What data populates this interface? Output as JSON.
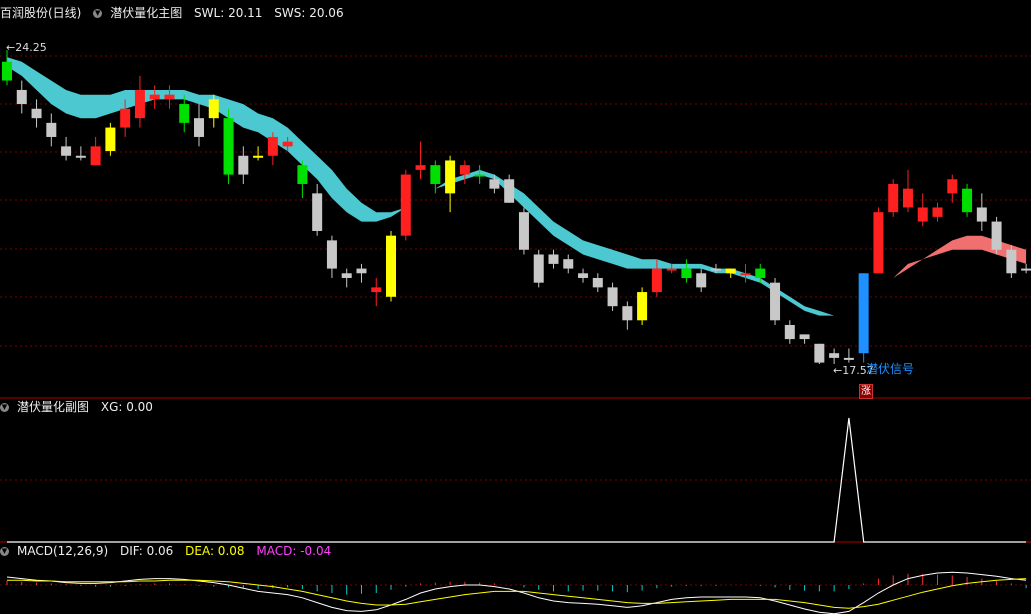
{
  "main_panel": {
    "stock_name": "百润股份(日线)",
    "indicator_name": "潜伏量化主图",
    "swl_label": "SWL: 20.11",
    "sws_label": "SWS: 20.06",
    "high_label": "24.25",
    "low_label": "17.57",
    "signal_label": "潜伏信号",
    "rise_badge": "涨"
  },
  "sub_panel": {
    "indicator_name": "潜伏量化副图",
    "xg_label": "XG: 0.00"
  },
  "macd_panel": {
    "indicator_name": "MACD(12,26,9)",
    "dif_label": "DIF: 0.06",
    "dea_label": "DEA: 0.08",
    "macd_label": "MACD: -0.04"
  },
  "colors": {
    "up": "#ff2020",
    "down": "#c8c8c8",
    "strong_up": "#ffff00",
    "strong_down": "#00e000",
    "signal": "#1e90ff",
    "band": "#4cc8d0",
    "band_up": "#f07070",
    "grid": "#7a0000",
    "divider": "#b00000"
  },
  "chart_data": {
    "type": "candlestick",
    "price_range_visible": [
      17.57,
      24.25
    ],
    "candles": [
      {
        "o": 24.0,
        "c": 23.6,
        "h": 24.25,
        "l": 23.5,
        "k": "g"
      },
      {
        "o": 23.4,
        "c": 23.1,
        "h": 23.6,
        "l": 22.9,
        "k": "d"
      },
      {
        "o": 23.0,
        "c": 22.8,
        "h": 23.2,
        "l": 22.6,
        "k": "d"
      },
      {
        "o": 22.7,
        "c": 22.4,
        "h": 22.9,
        "l": 22.2,
        "k": "d"
      },
      {
        "o": 22.2,
        "c": 22.0,
        "h": 22.4,
        "l": 21.9,
        "k": "d"
      },
      {
        "o": 22.0,
        "c": 22.0,
        "h": 22.2,
        "l": 21.9,
        "k": "d"
      },
      {
        "o": 21.8,
        "c": 22.2,
        "h": 22.4,
        "l": 21.8,
        "k": "u"
      },
      {
        "o": 22.1,
        "c": 22.6,
        "h": 22.7,
        "l": 22.0,
        "k": "y"
      },
      {
        "o": 22.6,
        "c": 23.0,
        "h": 23.2,
        "l": 22.4,
        "k": "u"
      },
      {
        "o": 22.8,
        "c": 23.4,
        "h": 23.7,
        "l": 22.6,
        "k": "u"
      },
      {
        "o": 23.2,
        "c": 23.3,
        "h": 23.5,
        "l": 23.0,
        "k": "u"
      },
      {
        "o": 23.2,
        "c": 23.3,
        "h": 23.5,
        "l": 23.0,
        "k": "u"
      },
      {
        "o": 23.1,
        "c": 22.7,
        "h": 23.3,
        "l": 22.5,
        "k": "g"
      },
      {
        "o": 22.8,
        "c": 22.4,
        "h": 23.1,
        "l": 22.2,
        "k": "d"
      },
      {
        "o": 22.8,
        "c": 23.2,
        "h": 23.3,
        "l": 22.6,
        "k": "y"
      },
      {
        "o": 22.8,
        "c": 21.6,
        "h": 23.0,
        "l": 21.4,
        "k": "g"
      },
      {
        "o": 22.0,
        "c": 21.6,
        "h": 22.2,
        "l": 21.4,
        "k": "d"
      },
      {
        "o": 22.0,
        "c": 22.0,
        "h": 22.2,
        "l": 21.9,
        "k": "y"
      },
      {
        "o": 22.0,
        "c": 22.4,
        "h": 22.5,
        "l": 21.8,
        "k": "u"
      },
      {
        "o": 22.2,
        "c": 22.3,
        "h": 22.4,
        "l": 22.1,
        "k": "u"
      },
      {
        "o": 21.8,
        "c": 21.4,
        "h": 21.9,
        "l": 21.1,
        "k": "g"
      },
      {
        "o": 21.2,
        "c": 20.4,
        "h": 21.4,
        "l": 20.3,
        "k": "d"
      },
      {
        "o": 20.2,
        "c": 19.6,
        "h": 20.3,
        "l": 19.4,
        "k": "d"
      },
      {
        "o": 19.5,
        "c": 19.4,
        "h": 19.6,
        "l": 19.2,
        "k": "d"
      },
      {
        "o": 19.6,
        "c": 19.5,
        "h": 19.7,
        "l": 19.3,
        "k": "d"
      },
      {
        "o": 19.2,
        "c": 19.1,
        "h": 19.4,
        "l": 18.8,
        "k": "u"
      },
      {
        "o": 19.0,
        "c": 20.3,
        "h": 20.4,
        "l": 18.9,
        "k": "y"
      },
      {
        "o": 20.3,
        "c": 21.6,
        "h": 21.7,
        "l": 20.2,
        "k": "u"
      },
      {
        "o": 21.7,
        "c": 21.8,
        "h": 22.3,
        "l": 21.5,
        "k": "u"
      },
      {
        "o": 21.8,
        "c": 21.4,
        "h": 21.9,
        "l": 21.2,
        "k": "g"
      },
      {
        "o": 21.2,
        "c": 21.9,
        "h": 22.0,
        "l": 20.8,
        "k": "y"
      },
      {
        "o": 21.8,
        "c": 21.6,
        "h": 21.9,
        "l": 21.4,
        "k": "u"
      },
      {
        "o": 21.6,
        "c": 21.6,
        "h": 21.8,
        "l": 21.4,
        "k": "g"
      },
      {
        "o": 21.5,
        "c": 21.3,
        "h": 21.6,
        "l": 21.2,
        "k": "d"
      },
      {
        "o": 21.5,
        "c": 21.0,
        "h": 21.6,
        "l": 21.0,
        "k": "d"
      },
      {
        "o": 20.8,
        "c": 20.0,
        "h": 20.9,
        "l": 19.9,
        "k": "d"
      },
      {
        "o": 19.9,
        "c": 19.3,
        "h": 20.0,
        "l": 19.2,
        "k": "d"
      },
      {
        "o": 19.9,
        "c": 19.7,
        "h": 20.0,
        "l": 19.6,
        "k": "d"
      },
      {
        "o": 19.8,
        "c": 19.6,
        "h": 19.9,
        "l": 19.5,
        "k": "d"
      },
      {
        "o": 19.5,
        "c": 19.4,
        "h": 19.6,
        "l": 19.3,
        "k": "d"
      },
      {
        "o": 19.4,
        "c": 19.2,
        "h": 19.5,
        "l": 19.1,
        "k": "d"
      },
      {
        "o": 19.2,
        "c": 18.8,
        "h": 19.3,
        "l": 18.7,
        "k": "d"
      },
      {
        "o": 18.8,
        "c": 18.5,
        "h": 18.9,
        "l": 18.3,
        "k": "d"
      },
      {
        "o": 18.5,
        "c": 19.1,
        "h": 19.2,
        "l": 18.4,
        "k": "y"
      },
      {
        "o": 19.1,
        "c": 19.6,
        "h": 19.8,
        "l": 19.0,
        "k": "u"
      },
      {
        "o": 19.6,
        "c": 19.6,
        "h": 19.7,
        "l": 19.5,
        "k": "u"
      },
      {
        "o": 19.6,
        "c": 19.4,
        "h": 19.8,
        "l": 19.3,
        "k": "g"
      },
      {
        "o": 19.5,
        "c": 19.2,
        "h": 19.6,
        "l": 19.1,
        "k": "d"
      },
      {
        "o": 19.6,
        "c": 19.6,
        "h": 19.7,
        "l": 19.5,
        "k": "d"
      },
      {
        "o": 19.5,
        "c": 19.6,
        "h": 19.6,
        "l": 19.4,
        "k": "y"
      },
      {
        "o": 19.5,
        "c": 19.5,
        "h": 19.7,
        "l": 19.3,
        "k": "u"
      },
      {
        "o": 19.6,
        "c": 19.4,
        "h": 19.7,
        "l": 19.3,
        "k": "g"
      },
      {
        "o": 19.3,
        "c": 18.5,
        "h": 19.4,
        "l": 18.4,
        "k": "d"
      },
      {
        "o": 18.4,
        "c": 18.1,
        "h": 18.5,
        "l": 18.0,
        "k": "d"
      },
      {
        "o": 18.2,
        "c": 18.1,
        "h": 18.2,
        "l": 18.0,
        "k": "d"
      },
      {
        "o": 18.0,
        "c": 17.6,
        "h": 18.0,
        "l": 17.57,
        "k": "d"
      },
      {
        "o": 17.8,
        "c": 17.7,
        "h": 17.9,
        "l": 17.57,
        "k": "d"
      },
      {
        "o": 17.7,
        "c": 17.7,
        "h": 17.9,
        "l": 17.6,
        "k": "d"
      },
      {
        "o": 17.8,
        "c": 19.5,
        "h": 19.5,
        "l": 17.6,
        "k": "s"
      },
      {
        "o": 19.5,
        "c": 20.8,
        "h": 20.9,
        "l": 19.5,
        "k": "u"
      },
      {
        "o": 20.8,
        "c": 21.4,
        "h": 21.5,
        "l": 20.7,
        "k": "u"
      },
      {
        "o": 20.9,
        "c": 21.3,
        "h": 21.7,
        "l": 20.8,
        "k": "u"
      },
      {
        "o": 20.6,
        "c": 20.9,
        "h": 21.2,
        "l": 20.5,
        "k": "u"
      },
      {
        "o": 20.9,
        "c": 20.7,
        "h": 21.0,
        "l": 20.6,
        "k": "u"
      },
      {
        "o": 21.2,
        "c": 21.5,
        "h": 21.6,
        "l": 21.0,
        "k": "u"
      },
      {
        "o": 21.3,
        "c": 20.8,
        "h": 21.4,
        "l": 20.7,
        "k": "g"
      },
      {
        "o": 20.9,
        "c": 20.6,
        "h": 21.2,
        "l": 20.4,
        "k": "d"
      },
      {
        "o": 20.6,
        "c": 20.0,
        "h": 20.7,
        "l": 19.9,
        "k": "d"
      },
      {
        "o": 20.0,
        "c": 19.5,
        "h": 20.1,
        "l": 19.4,
        "k": "d"
      },
      {
        "o": 19.6,
        "c": 19.6,
        "h": 19.7,
        "l": 19.5,
        "k": "d"
      }
    ],
    "band_lower": [
      23.9,
      23.7,
      23.4,
      23.1,
      22.9,
      22.8,
      22.8,
      22.9,
      23.0,
      23.1,
      23.2,
      23.2,
      23.2,
      23.1,
      23.0,
      22.8,
      22.6,
      22.5,
      22.3,
      22.1,
      21.8,
      21.5,
      21.1,
      20.8,
      20.6,
      20.6,
      20.7,
      20.9,
      21.1,
      21.3,
      21.4,
      21.5,
      21.6,
      21.5,
      21.2,
      20.9,
      20.6,
      20.3,
      20.1,
      19.9,
      19.8,
      19.7,
      19.6,
      19.6,
      19.6,
      19.6,
      19.6,
      19.6,
      19.5,
      19.5,
      19.4,
      19.3,
      19.1,
      18.9,
      18.7,
      18.6,
      18.6,
      18.6,
      18.8,
      19.1,
      19.4,
      19.7,
      19.8,
      19.9,
      20.0,
      20.0,
      20.0,
      19.9,
      19.8,
      19.7
    ],
    "band_upper": [
      24.1,
      24.0,
      23.8,
      23.6,
      23.4,
      23.3,
      23.3,
      23.3,
      23.4,
      23.4,
      23.4,
      23.4,
      23.4,
      23.3,
      23.3,
      23.2,
      23.1,
      22.9,
      22.8,
      22.6,
      22.3,
      22.0,
      21.7,
      21.3,
      21.0,
      20.8,
      20.8,
      20.9,
      21.1,
      21.3,
      21.5,
      21.6,
      21.7,
      21.6,
      21.4,
      21.2,
      20.9,
      20.6,
      20.4,
      20.2,
      20.1,
      20.0,
      19.9,
      19.8,
      19.8,
      19.7,
      19.7,
      19.7,
      19.6,
      19.6,
      19.5,
      19.4,
      19.2,
      19.0,
      18.8,
      18.7,
      18.6,
      18.6,
      18.8,
      19.1,
      19.4,
      19.6,
      19.8,
      20.0,
      20.2,
      20.3,
      20.3,
      20.2,
      20.1,
      20.0
    ],
    "signal_index": 57,
    "xg": [
      0,
      0,
      0,
      0,
      0,
      0,
      0,
      0,
      0,
      0,
      0,
      0,
      0,
      0,
      0,
      0,
      0,
      0,
      0,
      0,
      0,
      0,
      0,
      0,
      0,
      0,
      0,
      0,
      0,
      0,
      0,
      0,
      0,
      0,
      0,
      0,
      0,
      0,
      0,
      0,
      0,
      0,
      0,
      0,
      0,
      0,
      0,
      0,
      0,
      0,
      0,
      0,
      0,
      0,
      0,
      0,
      0,
      1,
      0,
      0,
      0,
      0,
      0,
      0,
      0,
      0,
      0,
      0,
      0,
      0
    ],
    "macd_hist": [
      0.05,
      0.04,
      0.03,
      0.02,
      0.01,
      -0.01,
      -0.02,
      -0.02,
      -0.01,
      0.01,
      0.02,
      0.02,
      0.01,
      -0.01,
      -0.02,
      -0.03,
      -0.04,
      -0.05,
      -0.04,
      -0.03,
      -0.05,
      -0.08,
      -0.1,
      -0.12,
      -0.11,
      -0.1,
      -0.06,
      -0.02,
      0.02,
      0.03,
      0.04,
      0.04,
      0.03,
      0.02,
      0.0,
      -0.03,
      -0.06,
      -0.08,
      -0.08,
      -0.07,
      -0.07,
      -0.08,
      -0.09,
      -0.07,
      -0.04,
      -0.02,
      -0.01,
      -0.01,
      -0.01,
      0.0,
      0.0,
      -0.01,
      -0.03,
      -0.06,
      -0.07,
      -0.08,
      -0.08,
      -0.05,
      0.02,
      0.08,
      0.12,
      0.14,
      0.14,
      0.13,
      0.12,
      0.1,
      0.08,
      0.05,
      0.02,
      -0.04
    ],
    "dif": [
      0.1,
      0.08,
      0.06,
      0.05,
      0.03,
      0.02,
      0.02,
      0.03,
      0.05,
      0.07,
      0.08,
      0.08,
      0.07,
      0.05,
      0.03,
      0.0,
      -0.04,
      -0.08,
      -0.1,
      -0.12,
      -0.16,
      -0.22,
      -0.28,
      -0.32,
      -0.33,
      -0.31,
      -0.25,
      -0.18,
      -0.1,
      -0.05,
      -0.02,
      0.0,
      0.0,
      -0.02,
      -0.05,
      -0.1,
      -0.16,
      -0.2,
      -0.22,
      -0.23,
      -0.24,
      -0.26,
      -0.28,
      -0.26,
      -0.22,
      -0.18,
      -0.16,
      -0.15,
      -0.15,
      -0.15,
      -0.15,
      -0.16,
      -0.2,
      -0.25,
      -0.3,
      -0.34,
      -0.36,
      -0.33,
      -0.22,
      -0.1,
      0.0,
      0.08,
      0.12,
      0.15,
      0.16,
      0.15,
      0.13,
      0.11,
      0.08,
      0.06
    ],
    "dea": [
      0.06,
      0.06,
      0.05,
      0.05,
      0.04,
      0.04,
      0.04,
      0.04,
      0.04,
      0.05,
      0.05,
      0.06,
      0.06,
      0.06,
      0.05,
      0.04,
      0.02,
      0.0,
      -0.02,
      -0.05,
      -0.08,
      -0.12,
      -0.16,
      -0.2,
      -0.23,
      -0.25,
      -0.25,
      -0.24,
      -0.21,
      -0.18,
      -0.15,
      -0.12,
      -0.1,
      -0.08,
      -0.08,
      -0.08,
      -0.1,
      -0.12,
      -0.14,
      -0.16,
      -0.18,
      -0.2,
      -0.22,
      -0.23,
      -0.23,
      -0.22,
      -0.21,
      -0.2,
      -0.19,
      -0.18,
      -0.18,
      -0.18,
      -0.18,
      -0.2,
      -0.22,
      -0.25,
      -0.28,
      -0.29,
      -0.27,
      -0.24,
      -0.19,
      -0.14,
      -0.09,
      -0.05,
      -0.01,
      0.02,
      0.04,
      0.06,
      0.07,
      0.08
    ]
  }
}
